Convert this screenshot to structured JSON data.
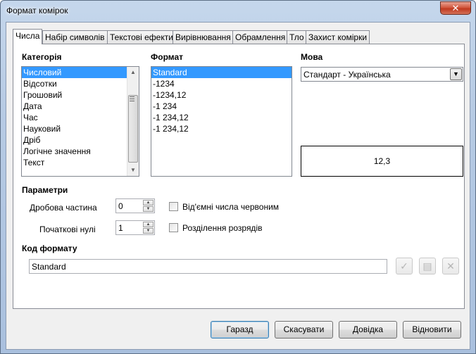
{
  "window": {
    "title": "Формат комірок",
    "close_glyph": "✕"
  },
  "tabs": [
    {
      "label": "Числа",
      "active": true
    },
    {
      "label": "Набір символів",
      "active": false
    },
    {
      "label": "Текстові ефекти",
      "active": false
    },
    {
      "label": "Вирівнювання",
      "active": false
    },
    {
      "label": "Обрамлення",
      "active": false
    },
    {
      "label": "Тло",
      "active": false
    },
    {
      "label": "Захист комірки",
      "active": false
    }
  ],
  "category": {
    "label": "Категорія",
    "items": [
      "Числовий",
      "Відсотки",
      "Грошовий",
      "Дата",
      "Час",
      "Науковий",
      "Дріб",
      "Логічне значення",
      "Текст"
    ],
    "selected_index": 0
  },
  "format": {
    "label": "Формат",
    "items": [
      "Standard",
      "-1234",
      "-1234,12",
      "-1 234",
      "-1 234,12",
      "-1 234,12"
    ],
    "selected_index": 0
  },
  "language": {
    "label": "Мова",
    "value": "Стандарт - Українська"
  },
  "preview": {
    "value": "12,3"
  },
  "options": {
    "label": "Параметри",
    "decimal_label": "Дробова частина",
    "decimal_value": "0",
    "leading_label": "Початкові нулі",
    "leading_value": "1",
    "negative_red_label": "Від'ємні числа червоним",
    "negative_red_checked": false,
    "thousands_label": "Розділення розрядів",
    "thousands_checked": false
  },
  "format_code": {
    "label": "Код формату",
    "value": "Standard"
  },
  "buttons": {
    "ok": "Гаразд",
    "cancel": "Скасувати",
    "help": "Довідка",
    "reset": "Відновити"
  },
  "colors": {
    "selection": "#3399ff",
    "title_gradient": "#b7cbe4",
    "close_red": "#c03a1f"
  }
}
